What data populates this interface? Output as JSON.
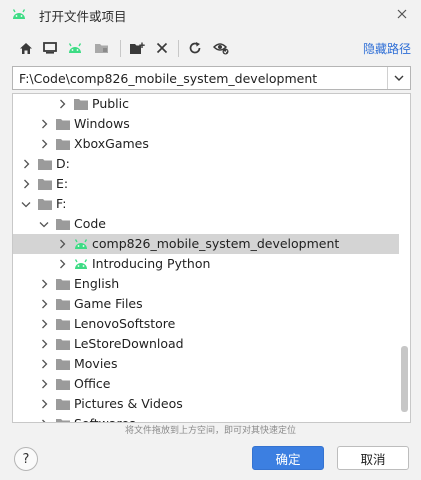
{
  "window": {
    "title": "打开文件或项目",
    "icon": "android-icon",
    "close_icon": "close-icon"
  },
  "toolbar": {
    "buttons": [
      {
        "name": "home-icon"
      },
      {
        "name": "desktop-icon"
      },
      {
        "name": "android-project-icon"
      },
      {
        "name": "module-folder-icon"
      },
      {
        "name": "new-folder-icon"
      },
      {
        "name": "delete-icon"
      },
      {
        "name": "refresh-icon"
      },
      {
        "name": "show-hidden-icon"
      }
    ],
    "hide_path_label": "隐藏路径"
  },
  "path": {
    "value": "F:\\Code\\comp826_mobile_system_development"
  },
  "tree": {
    "rows": [
      {
        "label": "Public",
        "expanded": false,
        "icon": "folder"
      },
      {
        "label": "Windows",
        "expanded": false,
        "icon": "folder"
      },
      {
        "label": "XboxGames",
        "expanded": false,
        "icon": "folder"
      },
      {
        "label": "D:",
        "expanded": false,
        "icon": "folder"
      },
      {
        "label": "E:",
        "expanded": false,
        "icon": "folder"
      },
      {
        "label": "F:",
        "expanded": true,
        "icon": "folder"
      },
      {
        "label": "Code",
        "expanded": true,
        "icon": "folder"
      },
      {
        "label": "comp826_mobile_system_development",
        "expanded": false,
        "icon": "android",
        "selected": true
      },
      {
        "label": "Introducing Python",
        "expanded": false,
        "icon": "android"
      },
      {
        "label": "English",
        "expanded": false,
        "icon": "folder"
      },
      {
        "label": "Game Files",
        "expanded": false,
        "icon": "folder"
      },
      {
        "label": "LenovoSoftstore",
        "expanded": false,
        "icon": "folder"
      },
      {
        "label": "LeStoreDownload",
        "expanded": false,
        "icon": "folder"
      },
      {
        "label": "Movies",
        "expanded": false,
        "icon": "folder"
      },
      {
        "label": "Office",
        "expanded": false,
        "icon": "folder"
      },
      {
        "label": "Pictures & Videos",
        "expanded": false,
        "icon": "folder"
      },
      {
        "label": "Softwares",
        "expanded": false,
        "icon": "folder"
      }
    ]
  },
  "hint": "将文件拖放到上方空间，即可对其快速定位",
  "buttons": {
    "ok": "确定",
    "cancel": "取消",
    "help": "?"
  },
  "colors": {
    "android_green": "#3ddc84",
    "accent": "#3c7fe1",
    "selection": "#d4d4d4",
    "link": "#2f6fd6"
  }
}
